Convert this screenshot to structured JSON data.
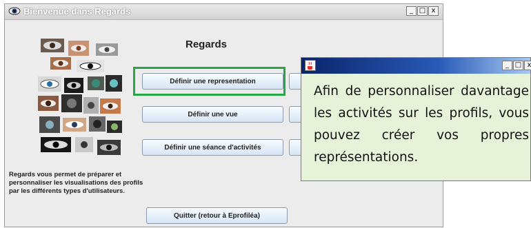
{
  "main_window": {
    "title": "Bienvenue dans Regards",
    "controls": {
      "minimize": "_",
      "maximize": "□",
      "close": "x"
    },
    "app_title": "Regards",
    "description": "Regards vous permet de préparer et personnaliser les visualisations des profils par les différents types d'utilisateurs.",
    "buttons": {
      "define_representation": "Définir une representation",
      "define_view": "Définir une vue",
      "define_session": "Définir une séance d'activités",
      "quit": "Quitter (retour à Eprofiléa)"
    }
  },
  "popup": {
    "controls": {
      "minimize": "_",
      "maximize": "□",
      "close": "x"
    },
    "message": "Afin de personnaliser davantage les activités sur les profils, vous pouvez créer vos propres représentations."
  },
  "colors": {
    "highlight": "#25a746",
    "popup_bg": "#e6f3d9",
    "popup_bar": "#0a246a"
  },
  "icons": [
    "eye-icon",
    "java-icon",
    "eyes-collage-image"
  ]
}
